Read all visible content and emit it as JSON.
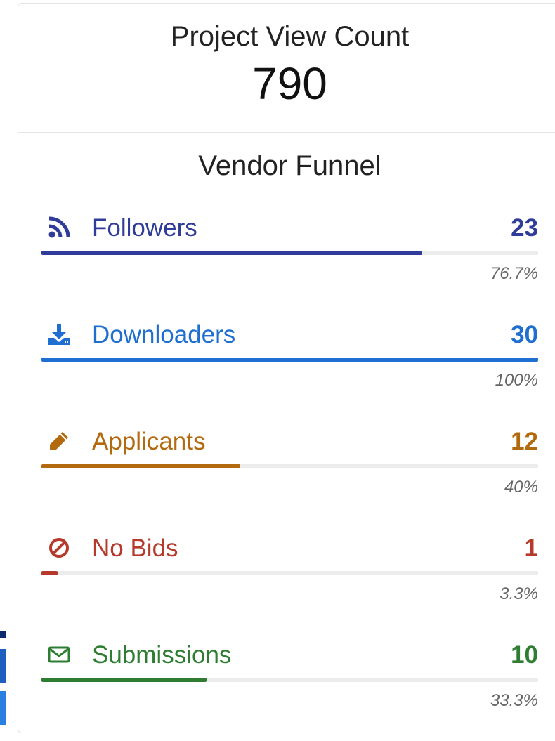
{
  "project_view": {
    "title": "Project View Count",
    "count": "790"
  },
  "vendor_funnel": {
    "title": "Vendor Funnel",
    "items": [
      {
        "label": "Followers",
        "count": "23",
        "percent_label": "76.7%",
        "fill_fraction": 0.767,
        "color": "#2f3c99",
        "icon": "rss-icon"
      },
      {
        "label": "Downloaders",
        "count": "30",
        "percent_label": "100%",
        "fill_fraction": 1.0,
        "color": "#1f6fd1",
        "icon": "download-icon"
      },
      {
        "label": "Applicants",
        "count": "12",
        "percent_label": "40%",
        "fill_fraction": 0.4,
        "color": "#b3690e",
        "icon": "pencil-icon"
      },
      {
        "label": "No Bids",
        "count": "1",
        "percent_label": "3.3%",
        "fill_fraction": 0.033,
        "color": "#b53a2b",
        "icon": "ban-icon"
      },
      {
        "label": "Submissions",
        "count": "10",
        "percent_label": "33.3%",
        "fill_fraction": 0.333,
        "color": "#2e7d32",
        "icon": "envelope-icon"
      }
    ]
  }
}
